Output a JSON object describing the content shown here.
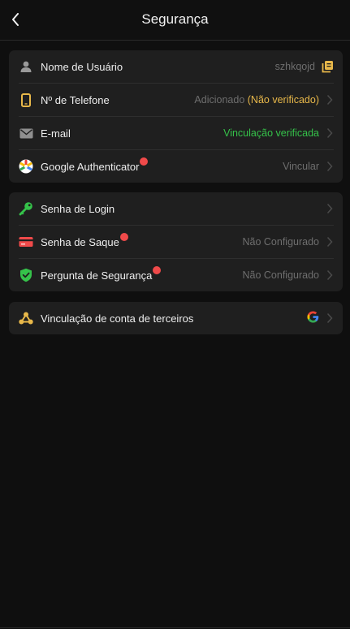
{
  "header": {
    "title": "Segurança"
  },
  "account": {
    "username": {
      "label": "Nome de Usuário",
      "value": "szhkqojd"
    },
    "phone": {
      "label": "Nº de Telefone",
      "value": "Adicionado",
      "status": "(Não verificado)"
    },
    "email": {
      "label": "E-mail",
      "value": "Vinculação verificada"
    },
    "google_auth": {
      "label": "Google Authenticator",
      "value": "Vincular"
    }
  },
  "passwords": {
    "login_password": {
      "label": "Senha de Login",
      "value": ""
    },
    "withdraw_password": {
      "label": "Senha de Saque",
      "value": "Não Configurado"
    },
    "security_question": {
      "label": "Pergunta de Segurança",
      "value": "Não Configurado"
    }
  },
  "third_party": {
    "label": "Vinculação de conta de terceiros"
  },
  "colors": {
    "background": "#0f0f0f",
    "card": "#1f1f1f",
    "accent_yellow": "#e8b84a",
    "success_green": "#35c24a",
    "alert_red": "#f04a4a",
    "muted_text": "#6e6e6e"
  }
}
